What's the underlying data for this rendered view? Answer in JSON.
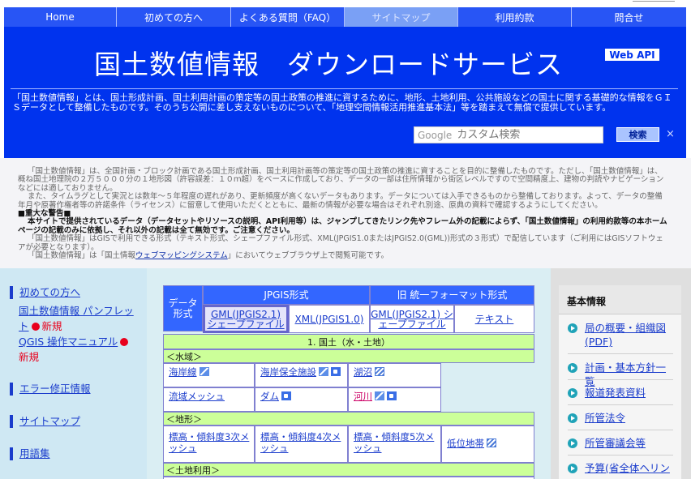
{
  "nav": {
    "items": [
      "Home",
      "初めての方へ",
      "よくある質問（FAQ）",
      "サイトマップ",
      "利用約款",
      "問合せ"
    ],
    "active_index": 3
  },
  "header": {
    "title": "国土数値情報　ダウンロードサービス",
    "webapi_label": "Web API",
    "description": "「国土数値情報」とは、国土形成計画、国土利用計画の策定等の国土政策の推進に資するために、地形、土地利用、公共施設などの国土に関する基礎的な情報をＧＩＳデータとして整備したものです。そのうち公開に差し支えないものについて、「地理空間情報活用推進基本法」等を踏まえて無償で提供しています。",
    "search": {
      "google_label": "Google",
      "placeholder": "カスタム検索",
      "button_label": "検索",
      "clear_symbol": "×"
    }
  },
  "notice": {
    "p1": "「国土数値情報」は、全国計画・ブロック計画である国土形成計画、国土利用計画等の策定等の国土政策の推進に資することを目的に整備したものです。ただし、「国土数値情報」は、概ね国土地理院の２万５０００分の１地形図（許容誤差：１０ｍ超）をベースに作成しており、データの一部は住所情報から街区レベルですので空間精度上、建物の判読やナビゲーションなどには適しておりません。",
    "p2": "また、タイムラグとして実況とは数年～５年程度の遅れがあり、更新頻度が高くないデータもあります。データについては入手できるものから整備しております。よって、データの整備年月や原著作権者等の許諾条件（ライセンス）に留意して使用いただくとともに、最新の情報が必要な場合はそれぞれ別途、原典の資料で確認するようにしてください。",
    "warn_head": "■重大な警告■",
    "warn_body": "本サイトで提供されているデータ（データセットやリソースの説明、API利用等）は、ジャンプしてきたリンク先やフレーム外の記載によらず、「国土数値情報」の利用約款等の本ホームページの記載のみに依拠し、それ以外の記載は全て無効です。ご注意ください。",
    "p3": "「国土数値情報」はGISで利用できる形式（テキスト形式、シェープファイル形式、XML(JPGIS1.0またはJPGIS2.0(GML))形式の３形式）で配信しています（ご利用にはGISソフトウェアが必要となります）。",
    "p4_pre": "「国土数値情報」は「国土情報",
    "p4_link": "ウェブマッピングシステム",
    "p4_post": "」においてウェブブラウザ上で閲覧可能です。"
  },
  "left_nav": {
    "beginner": "初めての方へ",
    "pamphlet": "国土数値情報 パンフレット",
    "qgis": "QGIS 操作マニュアル",
    "new_label": "新規",
    "errata": "エラー修正情報",
    "sitemap": "サイトマップ",
    "glossary": "用語集"
  },
  "table": {
    "format_label": "データ形式",
    "group_jpgis": "JPGIS形式",
    "group_old": "旧 統一フォーマット形式",
    "tab_gml": "GML(JPGIS2.1) シェープファイル",
    "tab_xml": "XML(JPGIS1.0)",
    "tab_gml_old": "GML(JPGIS2.1) シェープファイル",
    "tab_text": "テキスト",
    "section_title": "1. 国土（水・土地）",
    "sub_water": "＜水域＞",
    "sub_terrain": "＜地形＞",
    "sub_landuse": "＜土地利用＞",
    "water_items": [
      {
        "label": "海岸線",
        "icons": [
          "line"
        ]
      },
      {
        "label": "海岸保全施設",
        "icons": [
          "line",
          "point"
        ]
      },
      {
        "label": "湖沼",
        "icons": [
          "polygon"
        ]
      },
      {
        "label": "流域メッシュ",
        "icons": []
      },
      {
        "label": "ダム",
        "icons": [
          "point"
        ]
      },
      {
        "label": "河川",
        "icons": [
          "line",
          "point"
        ]
      }
    ],
    "terrain_items": [
      {
        "label": "標高・傾斜度3次メッシュ",
        "icons": []
      },
      {
        "label": "標高・傾斜度4次メッシュ",
        "icons": []
      },
      {
        "label": "標高・傾斜度5次メッシュ",
        "icons": []
      },
      {
        "label": "低位地帯",
        "icons": [
          "polygon"
        ]
      }
    ]
  },
  "right_nav": {
    "heading": "基本情報",
    "items": [
      "局の概要・組織図(PDF)",
      "計画・基本方針一覧",
      "報道発表資料",
      "所管法令",
      "所管審議会等",
      "予算(省全体ヘリン"
    ]
  }
}
